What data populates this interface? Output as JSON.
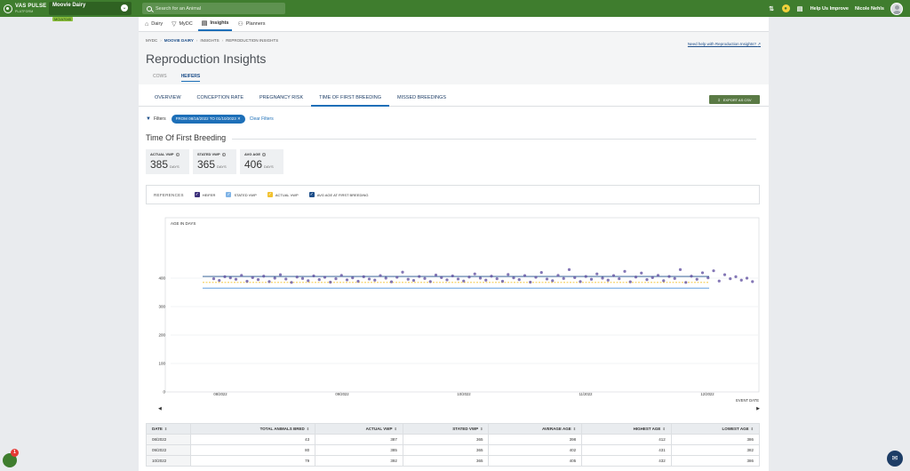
{
  "app": {
    "logo_text": "VAS PULSE",
    "logo_sub": "PLATFORM",
    "dairy_name": "Moovie Dairy",
    "dairy_code": "MCIA7045",
    "search_placeholder": "Search for an Animal",
    "help_label": "Help Us Improve",
    "user_name": "Nicole Nehls",
    "colors": {
      "topbar": "#3f7d2e",
      "accent": "#1d6fb8"
    }
  },
  "subnav": [
    {
      "label": "Dairy",
      "icon": "barn-icon"
    },
    {
      "label": "MyDC",
      "icon": "funnel-icon"
    },
    {
      "label": "Insights",
      "icon": "chart-icon",
      "active": true
    },
    {
      "label": "Planners",
      "icon": "people-icon"
    }
  ],
  "breadcrumb": [
    "MYDC",
    "MOOVIE DAIRY",
    "INSIGHTS",
    "REPRODUCTION INSIGHTS"
  ],
  "help_link": "Need help with Reproduction Insights?",
  "page_title": "Reproduction Insights",
  "herd_tabs": [
    {
      "label": "COWS",
      "active": false
    },
    {
      "label": "HEIFERS",
      "active": true
    }
  ],
  "analysis_tabs": [
    {
      "label": "OVERVIEW",
      "active": false
    },
    {
      "label": "CONCEPTION RATE",
      "active": false
    },
    {
      "label": "PREGNANCY RISK",
      "active": false
    },
    {
      "label": "TIME OF FIRST BREEDING",
      "active": true
    },
    {
      "label": "MISSED BREEDINGS",
      "active": false
    }
  ],
  "export_label": "EXPORT AS CSV",
  "filters": {
    "label": "Filters",
    "chip": "FROM 08/18/2022 TO 01/10/2023",
    "clear": "Clear Filters"
  },
  "section_title": "Time Of First Breeding",
  "stats": [
    {
      "label": "ACTUAL VWP",
      "value": "385",
      "unit": "DAYS"
    },
    {
      "label": "STATED VWP",
      "value": "365",
      "unit": "DAYS"
    },
    {
      "label": "AVG AGE",
      "value": "406",
      "unit": "DAYS"
    }
  ],
  "references": {
    "title": "REFERENCES",
    "items": [
      {
        "label": "HEIFER",
        "color": "#3b2f7a"
      },
      {
        "label": "STATED VWP",
        "color": "#7fb3e6"
      },
      {
        "label": "ACTUAL VWP",
        "color": "#f2c12e"
      },
      {
        "label": "AVG AGE AT FIRST BREEDING",
        "color": "#1d4e89"
      }
    ]
  },
  "chart_data": {
    "type": "scatter",
    "ylabel": "AGE IN DAYS",
    "xlabel": "EVENT DATE",
    "ylim": [
      0,
      500
    ],
    "yticks": [
      0,
      100,
      200,
      300,
      400
    ],
    "xticks": [
      "08/2022",
      "09/2022",
      "10/2022",
      "11/2022",
      "12/2022"
    ],
    "reference_lines": {
      "stated_vwp": 365,
      "actual_vwp": 385,
      "avg_age": 406
    },
    "series": [
      {
        "name": "HEIFER",
        "points": [
          [
            0.02,
            398
          ],
          [
            0.03,
            392
          ],
          [
            0.04,
            405
          ],
          [
            0.05,
            401
          ],
          [
            0.06,
            396
          ],
          [
            0.07,
            410
          ],
          [
            0.08,
            389
          ],
          [
            0.09,
            402
          ],
          [
            0.1,
            395
          ],
          [
            0.11,
            407
          ],
          [
            0.12,
            388
          ],
          [
            0.13,
            400
          ],
          [
            0.14,
            412
          ],
          [
            0.15,
            397
          ],
          [
            0.16,
            385
          ],
          [
            0.17,
            404
          ],
          [
            0.18,
            399
          ],
          [
            0.19,
            391
          ],
          [
            0.2,
            408
          ],
          [
            0.21,
            395
          ],
          [
            0.22,
            403
          ],
          [
            0.23,
            386
          ],
          [
            0.24,
            398
          ],
          [
            0.25,
            410
          ],
          [
            0.26,
            394
          ],
          [
            0.27,
            401
          ],
          [
            0.28,
            389
          ],
          [
            0.29,
            405
          ],
          [
            0.3,
            397
          ],
          [
            0.31,
            393
          ],
          [
            0.32,
            409
          ],
          [
            0.33,
            400
          ],
          [
            0.34,
            387
          ],
          [
            0.35,
            403
          ],
          [
            0.36,
            421
          ],
          [
            0.37,
            396
          ],
          [
            0.38,
            392
          ],
          [
            0.39,
            406
          ],
          [
            0.4,
            399
          ],
          [
            0.41,
            388
          ],
          [
            0.42,
            411
          ],
          [
            0.43,
            402
          ],
          [
            0.44,
            394
          ],
          [
            0.45,
            408
          ],
          [
            0.46,
            397
          ],
          [
            0.47,
            390
          ],
          [
            0.48,
            404
          ],
          [
            0.49,
            415
          ],
          [
            0.5,
            400
          ],
          [
            0.51,
            393
          ],
          [
            0.52,
            407
          ],
          [
            0.53,
            398
          ],
          [
            0.54,
            389
          ],
          [
            0.55,
            413
          ],
          [
            0.56,
            401
          ],
          [
            0.57,
            395
          ],
          [
            0.58,
            409
          ],
          [
            0.59,
            386
          ],
          [
            0.6,
            403
          ],
          [
            0.61,
            420
          ],
          [
            0.62,
            397
          ],
          [
            0.63,
            391
          ],
          [
            0.64,
            410
          ],
          [
            0.65,
            399
          ],
          [
            0.66,
            430
          ],
          [
            0.67,
            402
          ],
          [
            0.68,
            388
          ],
          [
            0.69,
            406
          ],
          [
            0.7,
            396
          ],
          [
            0.71,
            415
          ],
          [
            0.72,
            400
          ],
          [
            0.73,
            393
          ],
          [
            0.74,
            409
          ],
          [
            0.75,
            398
          ],
          [
            0.76,
            424
          ],
          [
            0.77,
            387
          ],
          [
            0.78,
            404
          ],
          [
            0.79,
            418
          ],
          [
            0.8,
            395
          ],
          [
            0.81,
            402
          ],
          [
            0.82,
            410
          ],
          [
            0.83,
            391
          ],
          [
            0.84,
            406
          ],
          [
            0.85,
            399
          ],
          [
            0.86,
            430
          ],
          [
            0.87,
            385
          ],
          [
            0.88,
            407
          ],
          [
            0.89,
            396
          ],
          [
            0.9,
            419
          ],
          [
            0.91,
            401
          ],
          [
            0.92,
            426
          ],
          [
            0.93,
            390
          ],
          [
            0.94,
            412
          ],
          [
            0.95,
            398
          ],
          [
            0.96,
            405
          ],
          [
            0.97,
            393
          ],
          [
            0.98,
            400
          ],
          [
            0.99,
            388
          ]
        ]
      }
    ],
    "grid": true
  },
  "table": {
    "headers": [
      "DATE",
      "TOTAL ANIMALS BRED",
      "ACTUAL VWP",
      "STATED VWP",
      "AVERAGE AGE",
      "HIGHEST AGE",
      "LOWEST AGE"
    ],
    "rows": [
      [
        "08/2022",
        "43",
        "387",
        "365",
        "398",
        "412",
        "386"
      ],
      [
        "09/2022",
        "80",
        "385",
        "365",
        "402",
        "431",
        "382"
      ],
      [
        "10/2022",
        "79",
        "392",
        "365",
        "405",
        "432",
        "386"
      ]
    ]
  },
  "notifications_count": "1"
}
